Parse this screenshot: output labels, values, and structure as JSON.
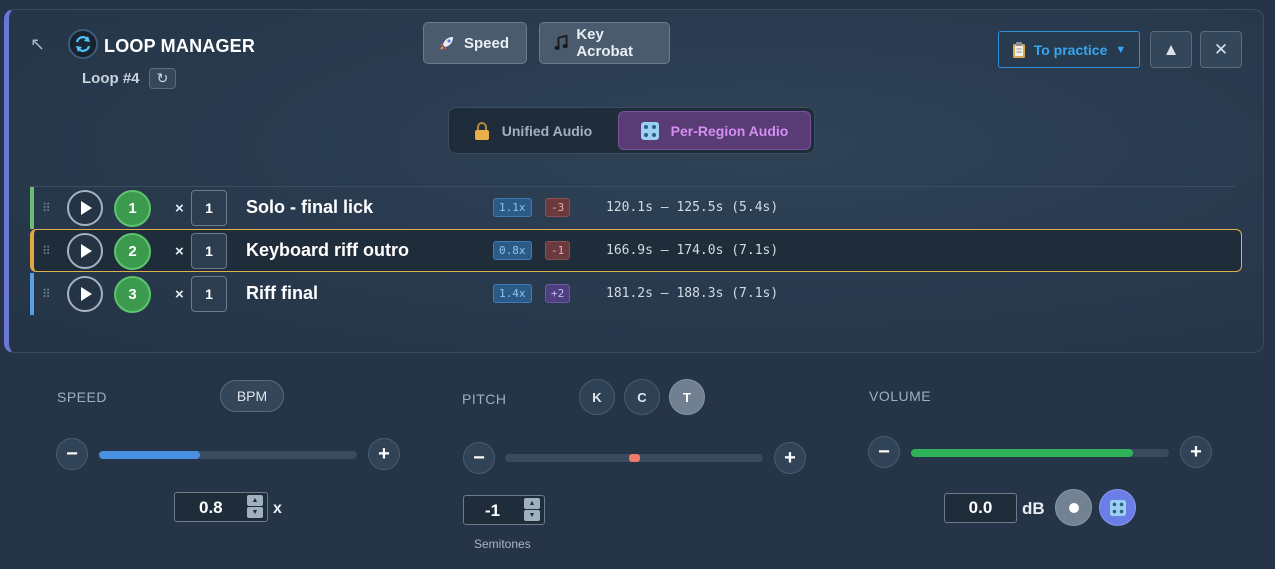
{
  "header": {
    "title": "LOOP MANAGER",
    "loop_label": "Loop #4",
    "reload_icon": "↻",
    "back_icon": "↖",
    "tools": [
      {
        "label": "Speed",
        "icon": "rocket-icon"
      },
      {
        "label": "Key Acrobat",
        "icon": "music-note-icon"
      }
    ],
    "practice_label": "To practice",
    "practice_caret": "▼",
    "collapse_icon": "▲",
    "close_icon": "✕"
  },
  "audio_mode": {
    "unified_label": "Unified Audio",
    "per_region_label": "Per-Region Audio",
    "selected": "Per-Region Audio"
  },
  "loops": [
    {
      "number": "1",
      "times_sign": "×",
      "repeat": "1",
      "name": "Solo - final lick",
      "speed": "1.1x",
      "pitch": "-3",
      "range": "120.1s – 125.5s (5.4s)",
      "color": "#6bbf6b",
      "active": false
    },
    {
      "number": "2",
      "times_sign": "×",
      "repeat": "1",
      "name": "Keyboard riff outro",
      "speed": "0.8x",
      "pitch": "-1",
      "range": "166.9s – 174.0s (7.1s)",
      "color": "#e0a840",
      "active": true
    },
    {
      "number": "3",
      "times_sign": "×",
      "repeat": "1",
      "name": "Riff final",
      "speed": "1.4x",
      "pitch": "+2",
      "range": "181.2s – 188.3s (7.1s)",
      "color": "#5aa0e0",
      "active": false
    }
  ],
  "speed": {
    "label": "SPEED",
    "bpm_label": "BPM",
    "minus": "−",
    "plus": "+",
    "value": "0.8",
    "unit": "x",
    "fill_fraction": 0.39,
    "fill_color": "#4a90e2"
  },
  "pitch": {
    "label": "PITCH",
    "knobs": [
      "K",
      "C",
      "T"
    ],
    "active_knob": "T",
    "minus": "−",
    "plus": "+",
    "value": "-1",
    "sublabel": "Semitones",
    "marker_fraction": 0.48,
    "marker_color": "#f07a6a"
  },
  "volume": {
    "label": "VOLUME",
    "minus": "−",
    "plus": "+",
    "value": "0.0",
    "unit": "dB",
    "fill_fraction": 0.86,
    "fill_color": "#2fb35a"
  }
}
